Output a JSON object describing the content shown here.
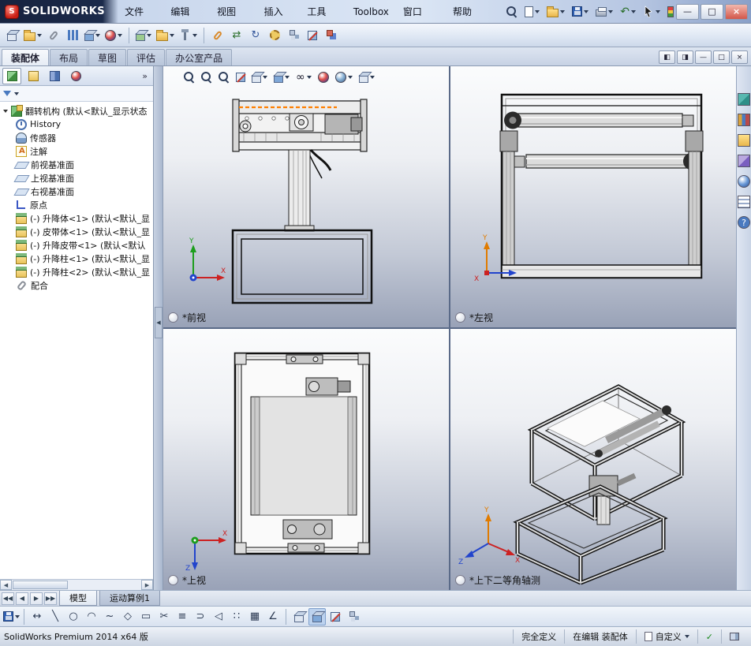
{
  "titlebar": {
    "brand": "SOLIDWORKS",
    "menus": [
      "文件(F)",
      "编辑(E)",
      "视图(V)",
      "插入(I)",
      "工具(T)",
      "Toolbox",
      "窗口(W)",
      "帮助(H)"
    ],
    "quick_toolbar_icons": [
      "search",
      "new",
      "open",
      "save",
      "print",
      "undo",
      "select-cursor",
      "rebuild"
    ],
    "window_controls": {
      "minimize": "—",
      "maximize": "□",
      "close": "×"
    }
  },
  "assembly_toolbar_icons": [
    "view-settings",
    "open-document",
    "attachment",
    "evaluate",
    "display-states",
    "appearances",
    "insert-component",
    "new-folder",
    "smart-fasteners",
    "mate",
    "move-component",
    "rotate-component",
    "assembly-features",
    "exploded-view",
    "section",
    "interference-detection"
  ],
  "command_tabs": {
    "active": "装配体",
    "items": [
      "装配体",
      "布局",
      "草图",
      "评估",
      "办公室产品"
    ]
  },
  "doc_window_controls": {
    "split_left": "◧",
    "split_right": "◨",
    "minimize": "—",
    "restore": "□",
    "close": "×"
  },
  "manager_panel": {
    "tab_icons": [
      "feature-manager",
      "property-manager",
      "configuration-manager",
      "display-manager"
    ],
    "overflow": "»",
    "tree": {
      "root": "翻转机构 (默认<默认_显示状态",
      "items": [
        {
          "icon": "history",
          "label": "History"
        },
        {
          "icon": "sensors",
          "label": "传感器"
        },
        {
          "icon": "annotations",
          "label": "注解"
        },
        {
          "icon": "plane",
          "label": "前视基准面"
        },
        {
          "icon": "plane",
          "label": "上视基准面"
        },
        {
          "icon": "plane",
          "label": "右视基准面"
        },
        {
          "icon": "origin",
          "label": "原点"
        },
        {
          "icon": "component",
          "label": "(-) 升降体<1> (默认<默认_显"
        },
        {
          "icon": "component",
          "label": "(-) 皮带体<1> (默认<默认_显"
        },
        {
          "icon": "component",
          "label": "(-) 升降皮带<1> (默认<默认"
        },
        {
          "icon": "component",
          "label": "(-) 升降柱<1> (默认<默认_显"
        },
        {
          "icon": "component",
          "label": "(-) 升降柱<2> (默认<默认_显"
        },
        {
          "icon": "mates",
          "label": "配合"
        }
      ]
    }
  },
  "heads_up_icons": [
    "zoom-fit",
    "zoom-area",
    "previous-view",
    "section-view",
    "view-orientation",
    "display-style",
    "hide-show-items",
    "edit-appearance",
    "apply-scene",
    "view-settings"
  ],
  "viewports": {
    "front": {
      "label": "*前视"
    },
    "left": {
      "label": "*左视"
    },
    "top": {
      "label": "*上视"
    },
    "isometric": {
      "label": "*上下二等角轴测"
    }
  },
  "triad": {
    "x": "X",
    "y": "Y",
    "z": "Z"
  },
  "task_pane_icons": [
    "solidworks-resources",
    "design-library",
    "file-explorer",
    "view-palette",
    "appearances-scenes",
    "custom-properties",
    "solidworks-forum"
  ],
  "document_tabs": {
    "active": "模型",
    "items": [
      "模型",
      "运动算例1"
    ]
  },
  "sketch_toolbar_icons": [
    "save",
    "smart-dimension",
    "line",
    "circle",
    "arc",
    "spline",
    "polygon",
    "rectangle",
    "trim",
    "convert-entities",
    "offset",
    "mirror",
    "linear-pattern",
    "grid",
    "angle",
    "shaded-cube",
    "section-view",
    "viewport-layout",
    "pane"
  ],
  "status_bar": {
    "left": "SolidWorks Premium 2014 x64 版",
    "definition": "完全定义",
    "editing": "在编辑 装配体",
    "custom": "自定义"
  }
}
